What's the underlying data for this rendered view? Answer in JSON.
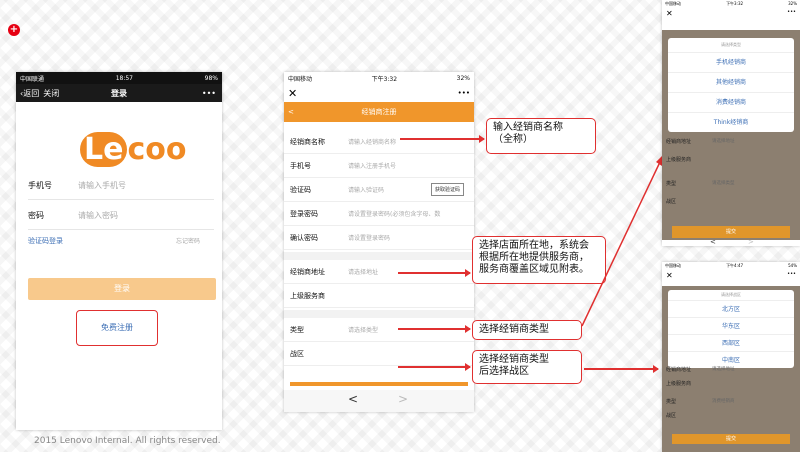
{
  "footer": "2015 Lenovo Internal. All rights reserved.",
  "phone1": {
    "status": {
      "carrier": "中国联通",
      "time": "18:57",
      "battery": "98%"
    },
    "nav": {
      "back": "返回",
      "close": "关闭",
      "title": "登录",
      "more": "•••"
    },
    "logo": {
      "le": "Le",
      "rest": "coo"
    },
    "phone_label": "手机号",
    "phone_placeholder": "请输入手机号",
    "pwd_label": "密码",
    "pwd_placeholder": "请输入密码",
    "code_login": "验证码登录",
    "forgot": "忘记密码",
    "login_btn": "登录",
    "register": "免费注册"
  },
  "phone2": {
    "status": {
      "carrier": "中国移动",
      "time": "下午3:32",
      "battery": "32%"
    },
    "close": "✕",
    "more": "•••",
    "header_back": "<",
    "header_title": "经销商注册",
    "fields": [
      {
        "label": "经销商名称",
        "placeholder": "请输入经销商名称"
      },
      {
        "label": "手机号",
        "placeholder": "请输入注册手机号"
      },
      {
        "label": "验证码",
        "placeholder": "请输入验证码",
        "button": "获取验证码"
      },
      {
        "label": "登录密码",
        "placeholder": "请设置登录密码(必须包含字母、数"
      },
      {
        "label": "确认密码",
        "placeholder": "请设置登录密码"
      }
    ],
    "address_label": "经销商地址",
    "address_placeholder": "请选择地址",
    "provider_label": "上级服务商",
    "type_label": "类型",
    "type_placeholder": "请选择类型",
    "zone_label": "战区",
    "nav_back": "<",
    "nav_fwd": ">"
  },
  "callouts": {
    "c1": "输入经销商名称\n（全称）",
    "c2": "选择店面所在地，系统会\n根据所在地提供服务商，\n服务商覆盖区域见附表。",
    "c3": "选择经销商类型",
    "c4": "选择经销商类型\n后选择战区"
  },
  "phone3": {
    "status": {
      "carrier": "中国移动",
      "time": "下午3:32",
      "battery": "32%"
    },
    "close": "✕",
    "more": "•••",
    "modal_title": "请选择类型",
    "options": [
      "手机经销商",
      "其他经销商",
      "消费经销商",
      "Think经销商"
    ],
    "rows": [
      {
        "label": "经销商地址",
        "ph": "请选择地址"
      },
      {
        "label": "上级服务商",
        "ph": ""
      },
      {
        "label": "类型",
        "ph": "请选择类型"
      },
      {
        "label": "战区",
        "ph": ""
      }
    ],
    "submit": "提交",
    "nav_back": "<",
    "nav_fwd": ">"
  },
  "phone4": {
    "status": {
      "carrier": "中国移动",
      "time": "下午4:47",
      "battery": "54%"
    },
    "close": "✕",
    "more": "•••",
    "modal_title": "请选择战区",
    "options": [
      "北方区",
      "华东区",
      "西部区",
      "中南区"
    ],
    "rows": [
      {
        "label": "经销商地址",
        "ph": "请选择地址"
      },
      {
        "label": "上级服务商",
        "ph": ""
      },
      {
        "label": "类型",
        "ph": "消费经销商"
      },
      {
        "label": "战区",
        "ph": ""
      }
    ],
    "submit": "提交"
  }
}
